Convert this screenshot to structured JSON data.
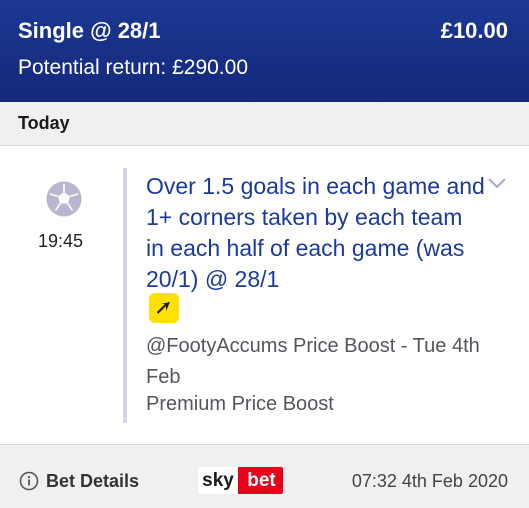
{
  "header": {
    "bet_type": "Single @ 28/1",
    "stake": "£10.00",
    "potential_return": "Potential return: £290.00"
  },
  "day_group": {
    "label": "Today"
  },
  "selection": {
    "sport_icon": "football-icon",
    "time": "19:45",
    "name": "Over 1.5 goals in each game and 1+ corners taken by each team in each half of each game (was 20/1) @ 28/1",
    "boost_icon": "price-boost-icon",
    "market": "@FootyAccums Price Boost - Tue 4th Feb",
    "market_sub": "Premium Price Boost",
    "expand_icon": "chevron-down-icon"
  },
  "footer": {
    "info_icon": "info-icon",
    "bet_details_label": "Bet Details",
    "logo": {
      "sky": "sky",
      "bet": "bet"
    },
    "timestamp": "07:32 4th Feb 2020"
  },
  "colors": {
    "header_bg": "#1c3893",
    "selection_text": "#1b3a9c",
    "boost_yellow": "#ffe000",
    "logo_red": "#e9001b",
    "panel_grey": "#f0f0f3"
  }
}
